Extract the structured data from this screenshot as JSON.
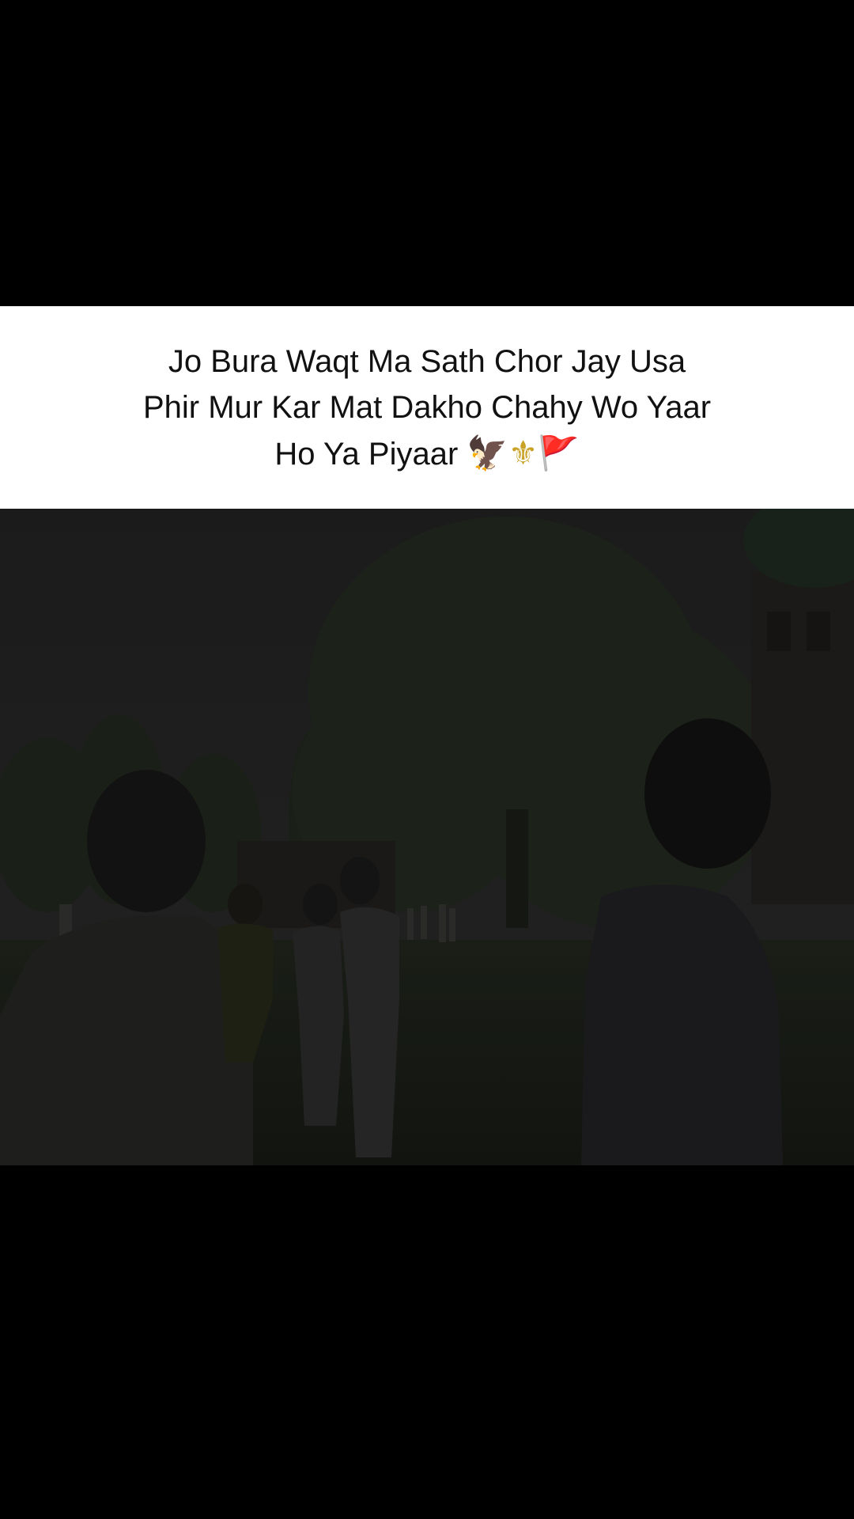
{
  "caption": {
    "lines": [
      "Jo Bura Waqt Ma Sath Chor Jay Usa",
      "Phir Mur Kar Mat Dakho Chahy Wo Yaar",
      "Ho Ya Piyaar"
    ],
    "emojis": [
      "🦅",
      "⚜",
      "🚩"
    ]
  },
  "colors": {
    "background": "#000000",
    "caption_card": "#ffffff",
    "caption_text": "#111111"
  }
}
